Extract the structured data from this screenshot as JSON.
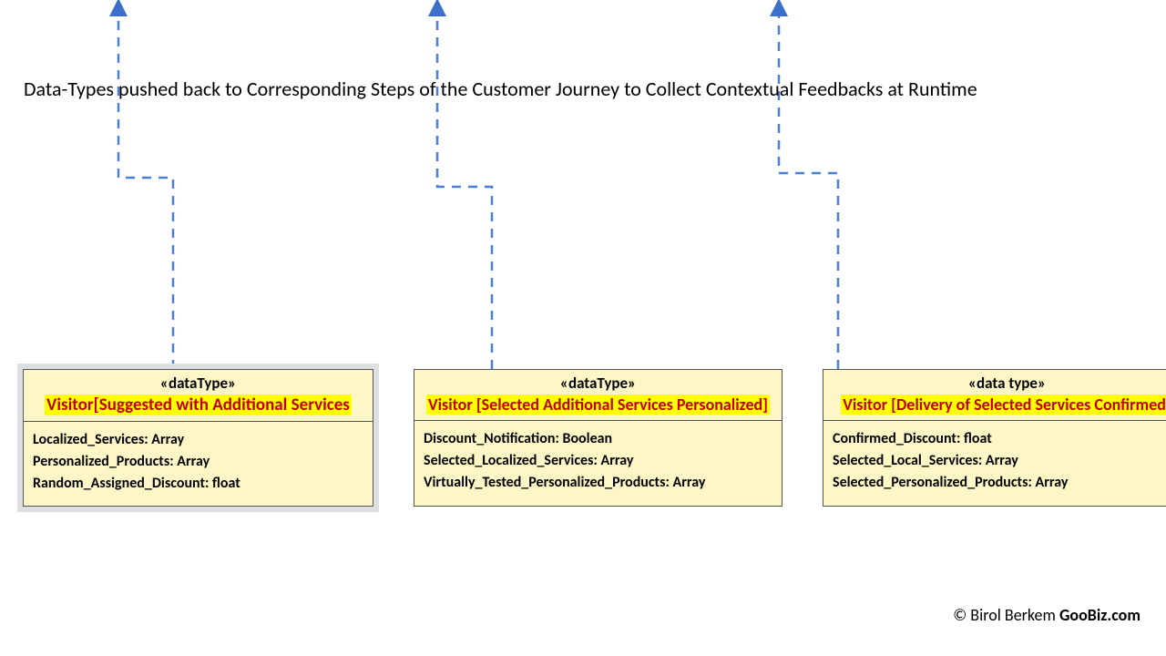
{
  "caption": "Data-Types pushed back to Corresponding Steps of the Customer Journey to Collect Contextual Feedbacks at Runtime",
  "boxes": [
    {
      "stereo": "«dataType»",
      "title": "Visitor[Suggested with Additional  Services",
      "attrs": [
        "Localized_Services: Array",
        "Personalized_Products: Array",
        "Random_Assigned_Discount: float"
      ]
    },
    {
      "stereo": "«dataType»",
      "title": "Visitor [Selected Additional  Services Personalized]",
      "attrs": [
        "Discount_Notification: Boolean",
        "Selected_Localized_Services: Array",
        "Virtually_Tested_Personalized_Products: Array"
      ]
    },
    {
      "stereo": "«data type»",
      "title": "Visitor [Delivery of Selected Services Confirmed]",
      "attrs": [
        "Confirmed_Discount: float",
        "Selected_Local_Services: Array",
        "Selected_Personalized_Products: Array"
      ]
    }
  ],
  "copyright_prefix": "© Birol Berkem ",
  "copyright_bold": "GooBiz.com"
}
